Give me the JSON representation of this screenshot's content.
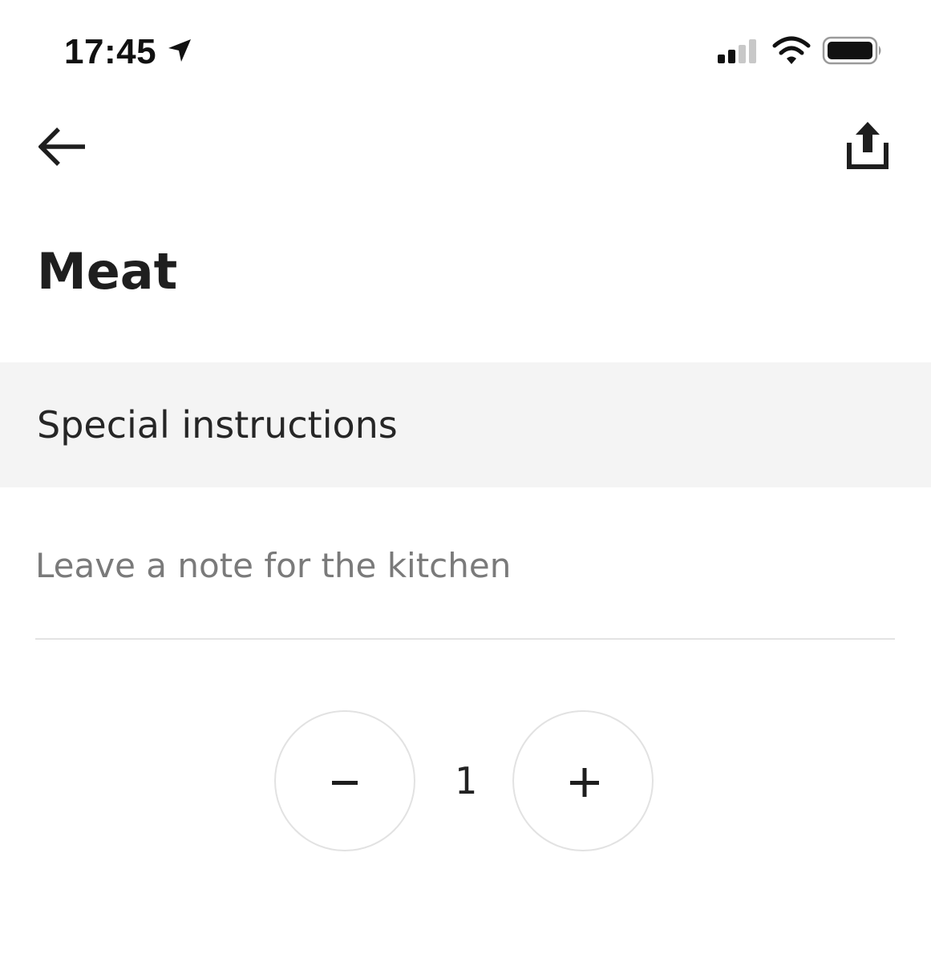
{
  "status_bar": {
    "time": "17:45",
    "icons": [
      "location-arrow-icon",
      "cellular-signal-icon",
      "wifi-icon",
      "battery-icon"
    ]
  },
  "nav": {
    "back_icon": "arrow-left-icon",
    "share_icon": "share-icon"
  },
  "item": {
    "title": "Meat"
  },
  "special_instructions": {
    "heading": "Special instructions",
    "note_value": "",
    "note_placeholder": "Leave a note for the kitchen"
  },
  "quantity": {
    "value": "1",
    "decrement_icon": "minus-icon",
    "increment_icon": "plus-icon"
  },
  "colors": {
    "text": "#222222",
    "placeholder": "#7a7a7a",
    "section_background": "#f4f4f4",
    "divider": "#e3e3e3",
    "stepper_border": "#e2e2e2"
  }
}
